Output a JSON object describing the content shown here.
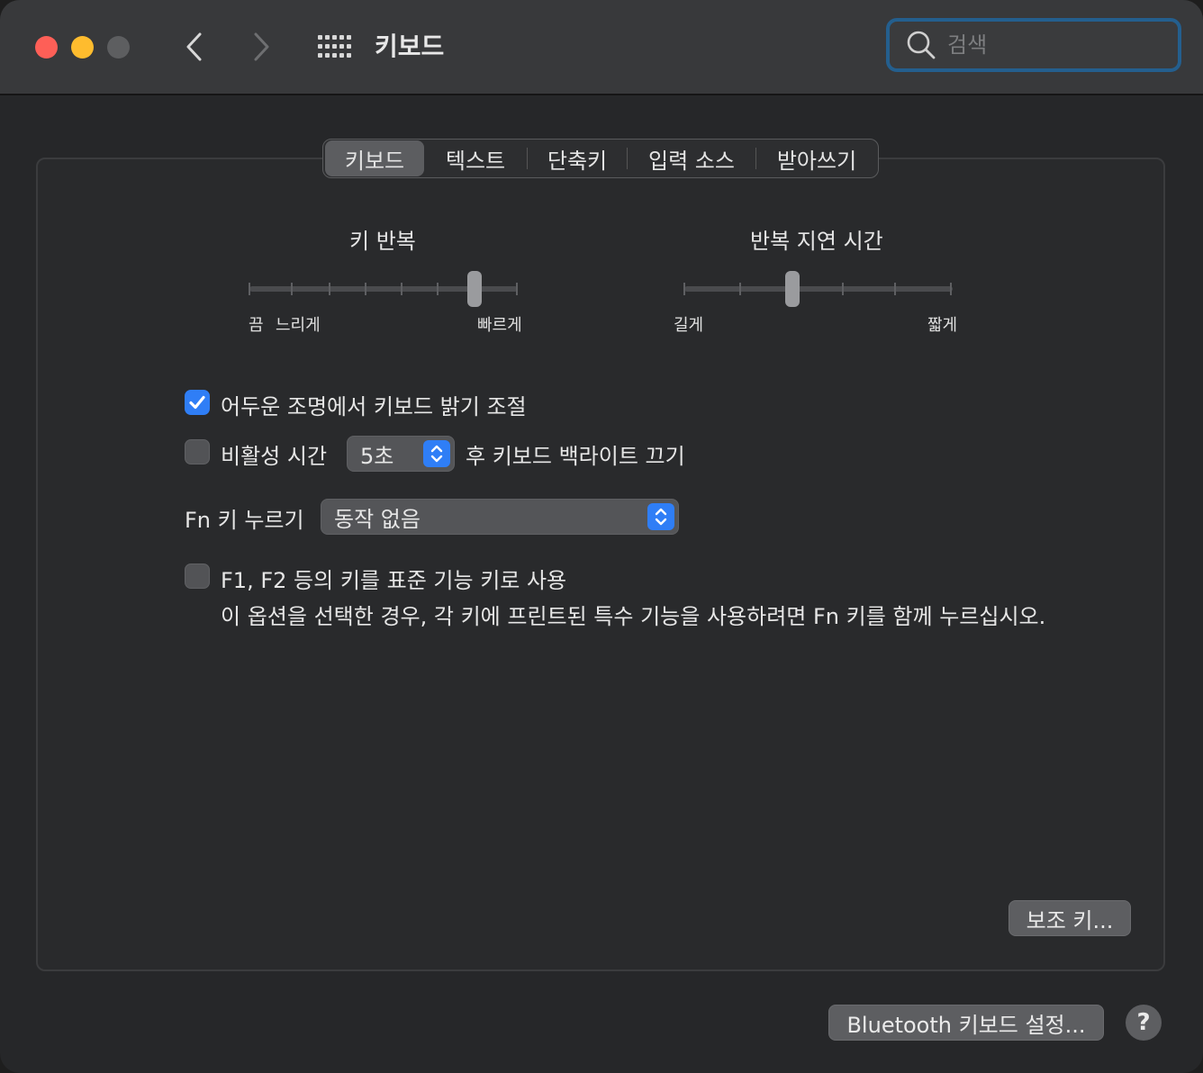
{
  "window": {
    "title": "키보드"
  },
  "search": {
    "placeholder": "검색"
  },
  "tabs": [
    {
      "label": "키보드",
      "active": true
    },
    {
      "label": "텍스트",
      "active": false
    },
    {
      "label": "단축키",
      "active": false
    },
    {
      "label": "입력 소스",
      "active": false
    },
    {
      "label": "받아쓰기",
      "active": false
    }
  ],
  "key_repeat": {
    "label": "키 반복",
    "min_label": "끔",
    "slow_label": "느리게",
    "fast_label": "빠르게",
    "ticks": 8,
    "value_index": 6
  },
  "repeat_delay": {
    "label": "반복 지연 시간",
    "long_label": "길게",
    "short_label": "짧게",
    "ticks": 6,
    "value_index": 2
  },
  "options": {
    "adjust_brightness": {
      "label": "어두운 조명에서 키보드 밝기 조절",
      "checked": true
    },
    "backlight_off": {
      "label_before": "비활성 시간",
      "value": "5초",
      "label_after": "후 키보드 백라이트 끄기",
      "checked": false
    },
    "fn_key": {
      "label": "Fn 키 누르기",
      "value": "동작 없음"
    },
    "function_keys": {
      "label": "F1, F2 등의 키를 표준 기능 키로 사용",
      "description": "이 옵션을 선택한 경우, 각 키에 프린트된 특수 기능을 사용하려면 Fn 키를 함께 누르십시오.",
      "checked": false
    }
  },
  "buttons": {
    "modifier_keys": "보조 키...",
    "bluetooth": "Bluetooth 키보드 설정...",
    "help": "?"
  },
  "colors": {
    "accent": "#2f7ef6",
    "close": "#fe5f57",
    "minimize": "#febc2e",
    "focus_ring": "#245f8e"
  }
}
